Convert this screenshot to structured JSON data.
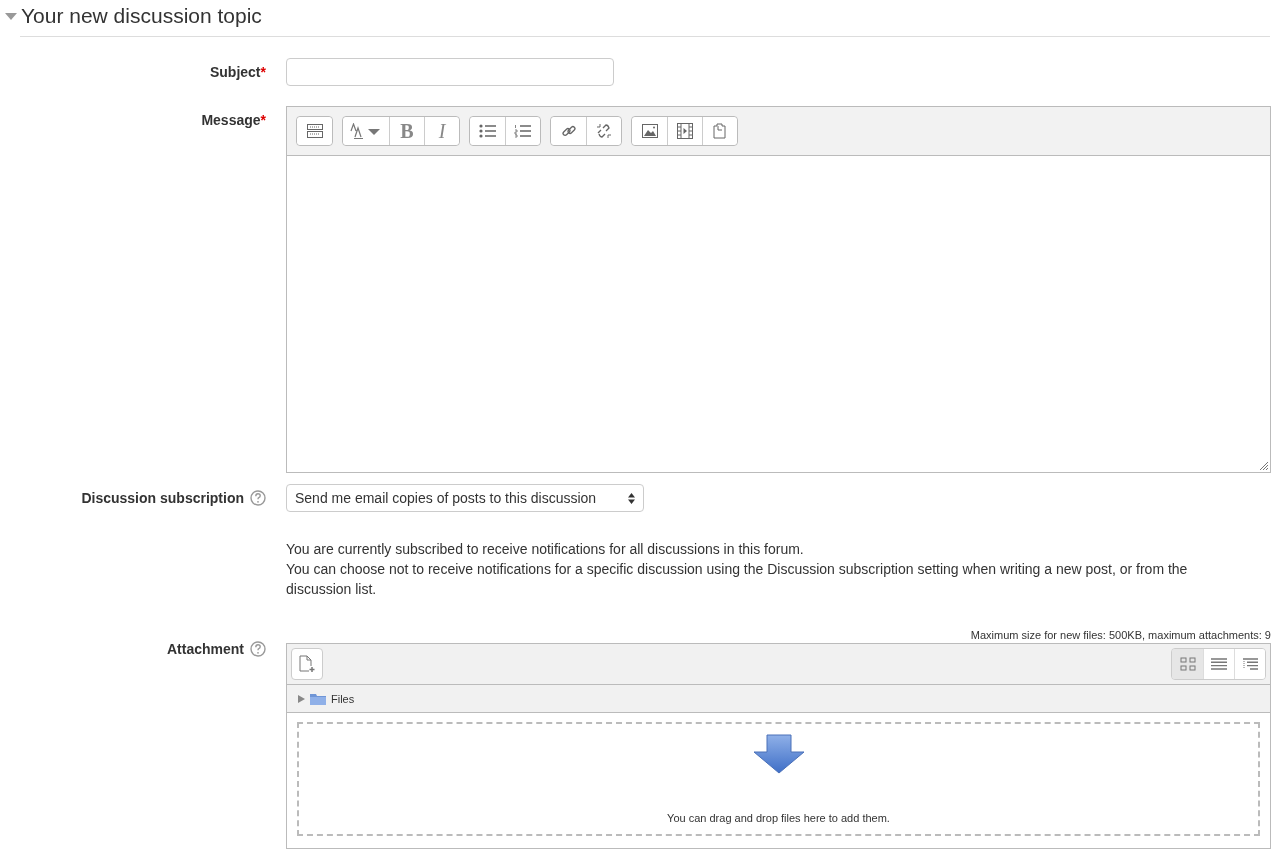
{
  "section": {
    "title": "Your new discussion topic",
    "expanded": true
  },
  "subject": {
    "label": "Subject",
    "required_mark": "*"
  },
  "message": {
    "label": "Message",
    "required_mark": "*",
    "toolbar": [
      {
        "buttons": [
          {
            "kind": "toolbar-toggle"
          }
        ]
      },
      {
        "buttons": [
          {
            "kind": "font-size"
          },
          {
            "kind": "bold",
            "label": "B"
          },
          {
            "kind": "italic",
            "label": "I"
          }
        ]
      },
      {
        "buttons": [
          {
            "kind": "bullet-list"
          },
          {
            "kind": "numbered-list"
          }
        ]
      },
      {
        "buttons": [
          {
            "kind": "link"
          },
          {
            "kind": "unlink"
          }
        ]
      },
      {
        "buttons": [
          {
            "kind": "image"
          },
          {
            "kind": "media"
          },
          {
            "kind": "paste"
          }
        ]
      }
    ]
  },
  "subscription": {
    "label": "Discussion subscription",
    "value": "Send me email copies of posts to this discussion",
    "notes": [
      "You are currently subscribed to receive notifications for all discussions in this forum.",
      "You can choose not to receive notifications for a specific discussion using the Discussion subscription setting when writing a new post, or from the discussion list."
    ]
  },
  "attachment": {
    "label": "Attachment",
    "limits": "Maximum size for new files: 500KB, maximum attachments: 9",
    "view_modes": [
      {
        "kind": "icons",
        "selected": true
      },
      {
        "kind": "details",
        "selected": false
      },
      {
        "kind": "tree",
        "selected": false
      }
    ],
    "folder": {
      "name": "Files",
      "expanded": false
    },
    "drop_hint": "You can drag and drop files here to add them."
  }
}
